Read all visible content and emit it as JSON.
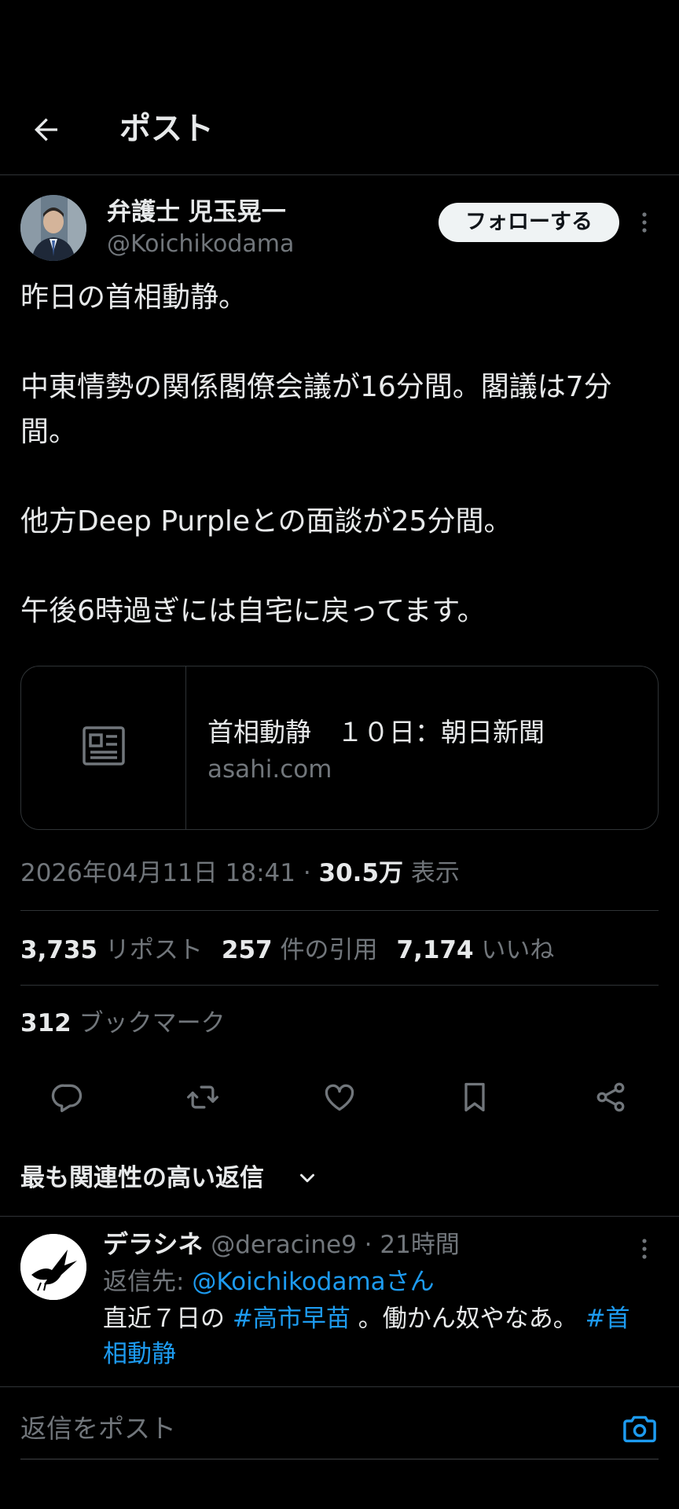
{
  "header": {
    "title": "ポスト"
  },
  "post": {
    "author_name": "弁護士 児玉晃一",
    "author_handle": "@Koichikodama",
    "follow_label": "フォローする",
    "text": "昨日の首相動静。\n\n中東情勢の関係閣僚会議が16分間。閣議は7分間。\n\n他方Deep Purpleとの面談が25分間。\n\n午後6時過ぎには自宅に戻ってます。",
    "link_card": {
      "title": "首相動静　１０日：朝日新聞",
      "domain": "asahi.com"
    },
    "timestamp": "2026年04月11日 18:41",
    "separator": " · ",
    "views_count": "30.5万",
    "views_label": "表示"
  },
  "stats": {
    "reposts_count": "3,735",
    "reposts_label": "リポスト",
    "quotes_count": "257",
    "quotes_label": "件の引用",
    "likes_count": "7,174",
    "likes_label": "いいね",
    "bookmarks_count": "312",
    "bookmarks_label": "ブックマーク"
  },
  "actions": [
    "reply-icon",
    "repost-icon",
    "like-icon",
    "bookmark-icon",
    "share-icon"
  ],
  "replies_heading": "最も関連性の高い返信",
  "reply": {
    "name": "デラシネ",
    "handle": "@deracine9",
    "separator": " · ",
    "time": "21時間",
    "reply_to_label": "返信先: ",
    "reply_to_handle": "@Koichikodamaさん",
    "text_1": "直近７日の ",
    "hashtag_1": "#高市早苗",
    "text_2": " 。働かん奴やなあ。",
    "hashtag_2": "#首相動静"
  },
  "compose": {
    "placeholder": "返信をポスト"
  },
  "colors": {
    "background": "#000000",
    "text": "#e7e9ea",
    "muted": "#71767b",
    "link": "#1d9bf0",
    "divider": "#2f3336"
  }
}
